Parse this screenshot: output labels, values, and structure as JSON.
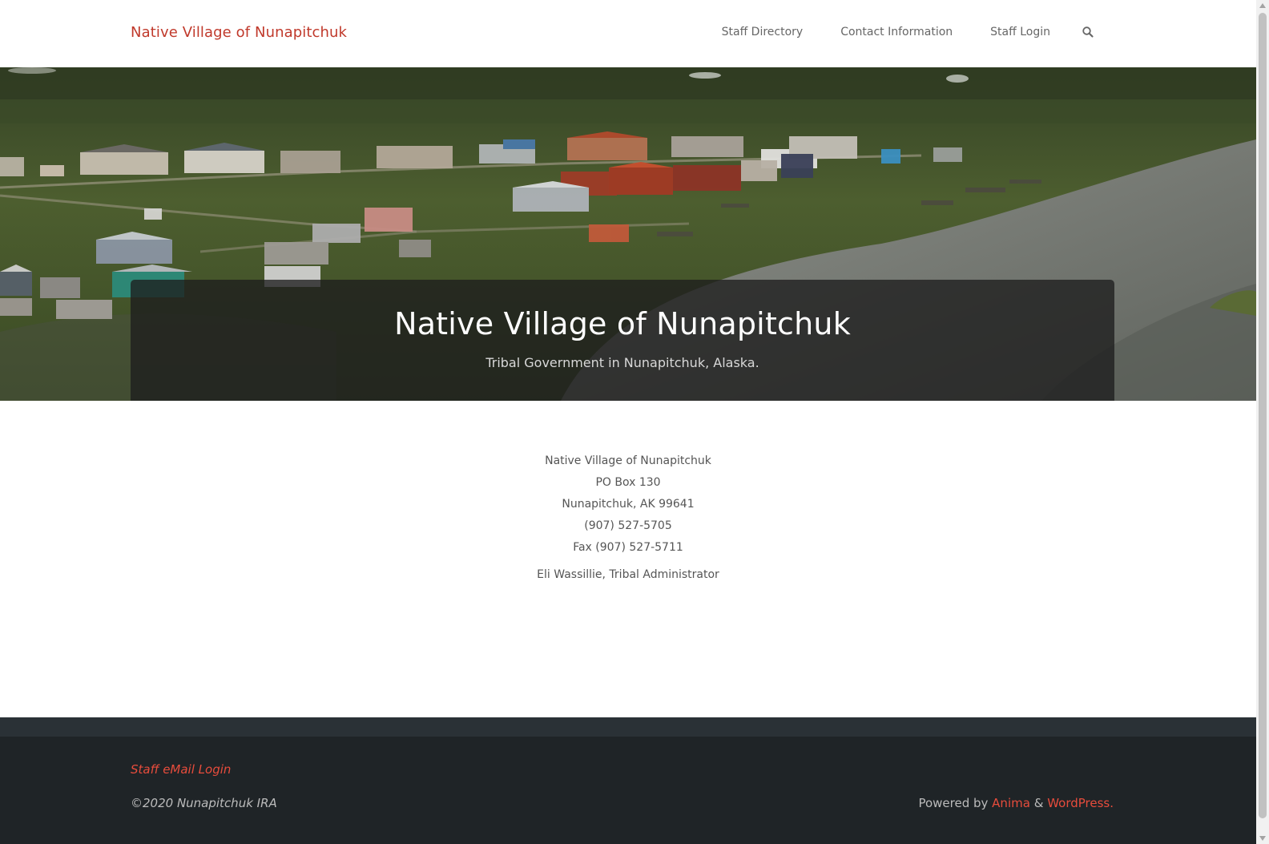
{
  "header": {
    "brand": "Native Village of Nunapitchuk",
    "nav": {
      "staff_directory": "Staff Directory",
      "contact_information": "Contact Information",
      "staff_login": "Staff Login"
    },
    "search_icon": "search-icon"
  },
  "hero": {
    "title": "Native Village of Nunapitchuk",
    "subtitle": "Tribal Government in Nunapitchuk, Alaska.",
    "image": "aerial-village-photo"
  },
  "content": {
    "address_lines": [
      "Native Village of Nunapitchuk",
      "PO Box 130",
      "Nunapitchuk, AK  99641",
      "(907) 527-5705",
      "Fax (907) 527-5711"
    ],
    "administrator": "Eli Wassillie, Tribal Administrator"
  },
  "footer": {
    "email_login": "Staff eMail Login",
    "copyright": "©2020 Nunapitchuk IRA",
    "powered_prefix": "Powered by",
    "powered_anima": "Anima",
    "powered_amp": "&",
    "powered_wordpress": "WordPress."
  },
  "colors": {
    "accent": "#c0392b",
    "footer_bg": "#1f2427",
    "hero_overlay": "#1e1e1e"
  }
}
